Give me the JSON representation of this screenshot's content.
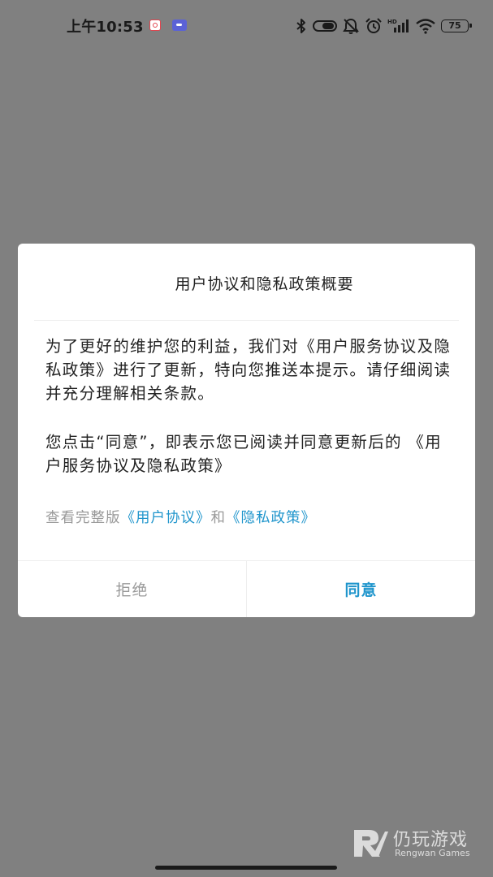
{
  "status_bar": {
    "time": "上午10:53",
    "battery_level": "75",
    "icons": [
      "bluetooth-icon",
      "vibrate-icon",
      "mute-icon",
      "alarm-icon",
      "hd-signal-icon",
      "wifi-icon",
      "battery-icon"
    ]
  },
  "dialog": {
    "title": "用户协议和隐私政策概要",
    "paragraph_1": "为了更好的维护您的利益，我们对《用户服务协议及隐私政策》进行了更新，特向您推送本提示。请仔细阅读并充分理解相关条款。",
    "paragraph_2": "您点击“同意”，即表示您已阅读并同意更新后的 《用户服务协议及隐私政策》",
    "links": {
      "prefix": "查看完整版",
      "user_agreement": "《用户协议》",
      "connector": "和",
      "privacy_policy": "《隐私政策》"
    },
    "buttons": {
      "reject": "拒绝",
      "agree": "同意"
    }
  },
  "watermark": {
    "name_cn": "仍玩游戏",
    "name_en": "Rengwan Games"
  },
  "colors": {
    "overlay": "#808080",
    "accent": "#1f95cc",
    "muted_text": "#999999",
    "body_text": "#222222"
  }
}
